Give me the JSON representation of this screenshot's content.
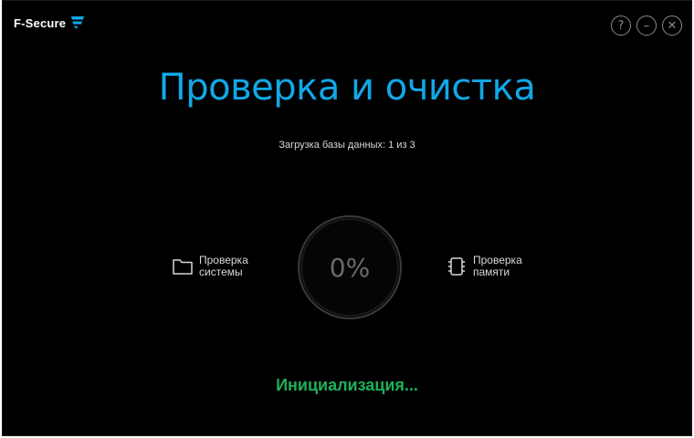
{
  "app": {
    "brand": "F-Secure",
    "accent_color": "#11a8e8",
    "status_color": "#1fb05a"
  },
  "window_controls": {
    "help_icon": "help-icon",
    "help_glyph": "?",
    "minimize_icon": "minimize-icon",
    "minimize_glyph": "–",
    "close_icon": "close-icon",
    "close_glyph": "✕"
  },
  "main": {
    "title": "Проверка и очистка",
    "subtitle": "Загрузка базы данных: 1 из 3",
    "progress_percent": 0,
    "progress_label": "0%",
    "status": "Инициализация..."
  },
  "scan_items": [
    {
      "icon": "folder-icon",
      "label_line1": "Проверка",
      "label_line2": "системы"
    },
    {
      "icon": "memory-icon",
      "label_line1": "Проверка",
      "label_line2": "памяти"
    }
  ]
}
